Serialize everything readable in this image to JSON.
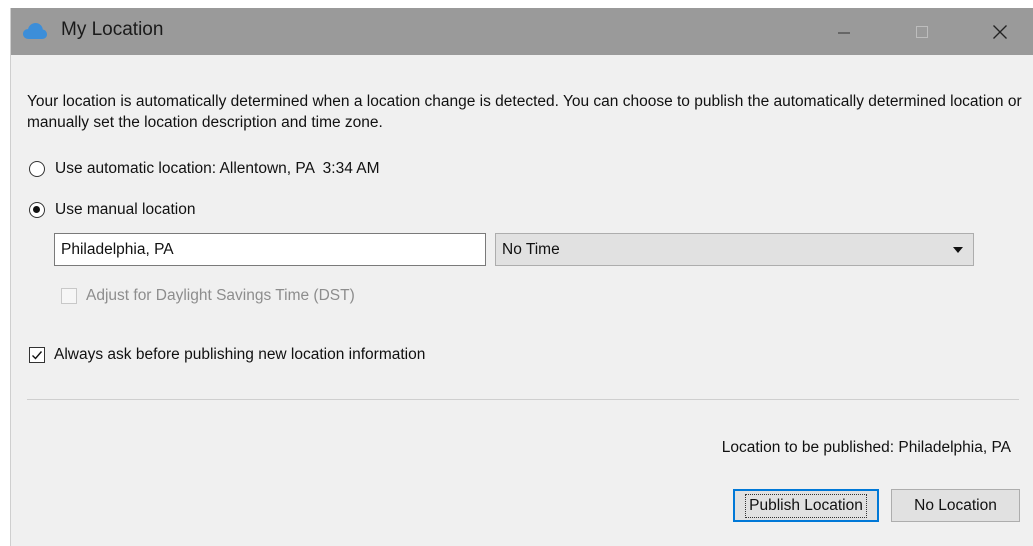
{
  "window": {
    "title": "My Location",
    "app_icon": "cloud-icon",
    "controls": {
      "minimize": "minimize-icon",
      "maximize": "maximize-icon",
      "close": "close-icon"
    }
  },
  "description": "Your location is automatically determined when a location change is detected. You can choose to publish the automatically determined location or manually set the location description and time zone.",
  "automatic_option": {
    "label": "Use automatic location: Allentown, PA  3:34 AM",
    "selected": false
  },
  "manual_option": {
    "label": "Use manual location",
    "selected": true
  },
  "location_input": {
    "value": "Philadelphia, PA"
  },
  "timezone_select": {
    "selected": "No Time"
  },
  "dst_checkbox": {
    "label": "Adjust for Daylight Savings Time (DST)",
    "checked": false,
    "enabled": false
  },
  "always_ask_checkbox": {
    "label": "Always ask before publishing new location information",
    "checked": true
  },
  "publish_status": "Location to be published: Philadelphia, PA",
  "buttons": {
    "publish": "Publish Location",
    "no_location": "No Location"
  },
  "colors": {
    "titlebar": "#9a9a9a",
    "dialog_background": "#f0f0f0",
    "focus_border": "#0078d7",
    "cloud_icon": "#3c8ed9"
  }
}
